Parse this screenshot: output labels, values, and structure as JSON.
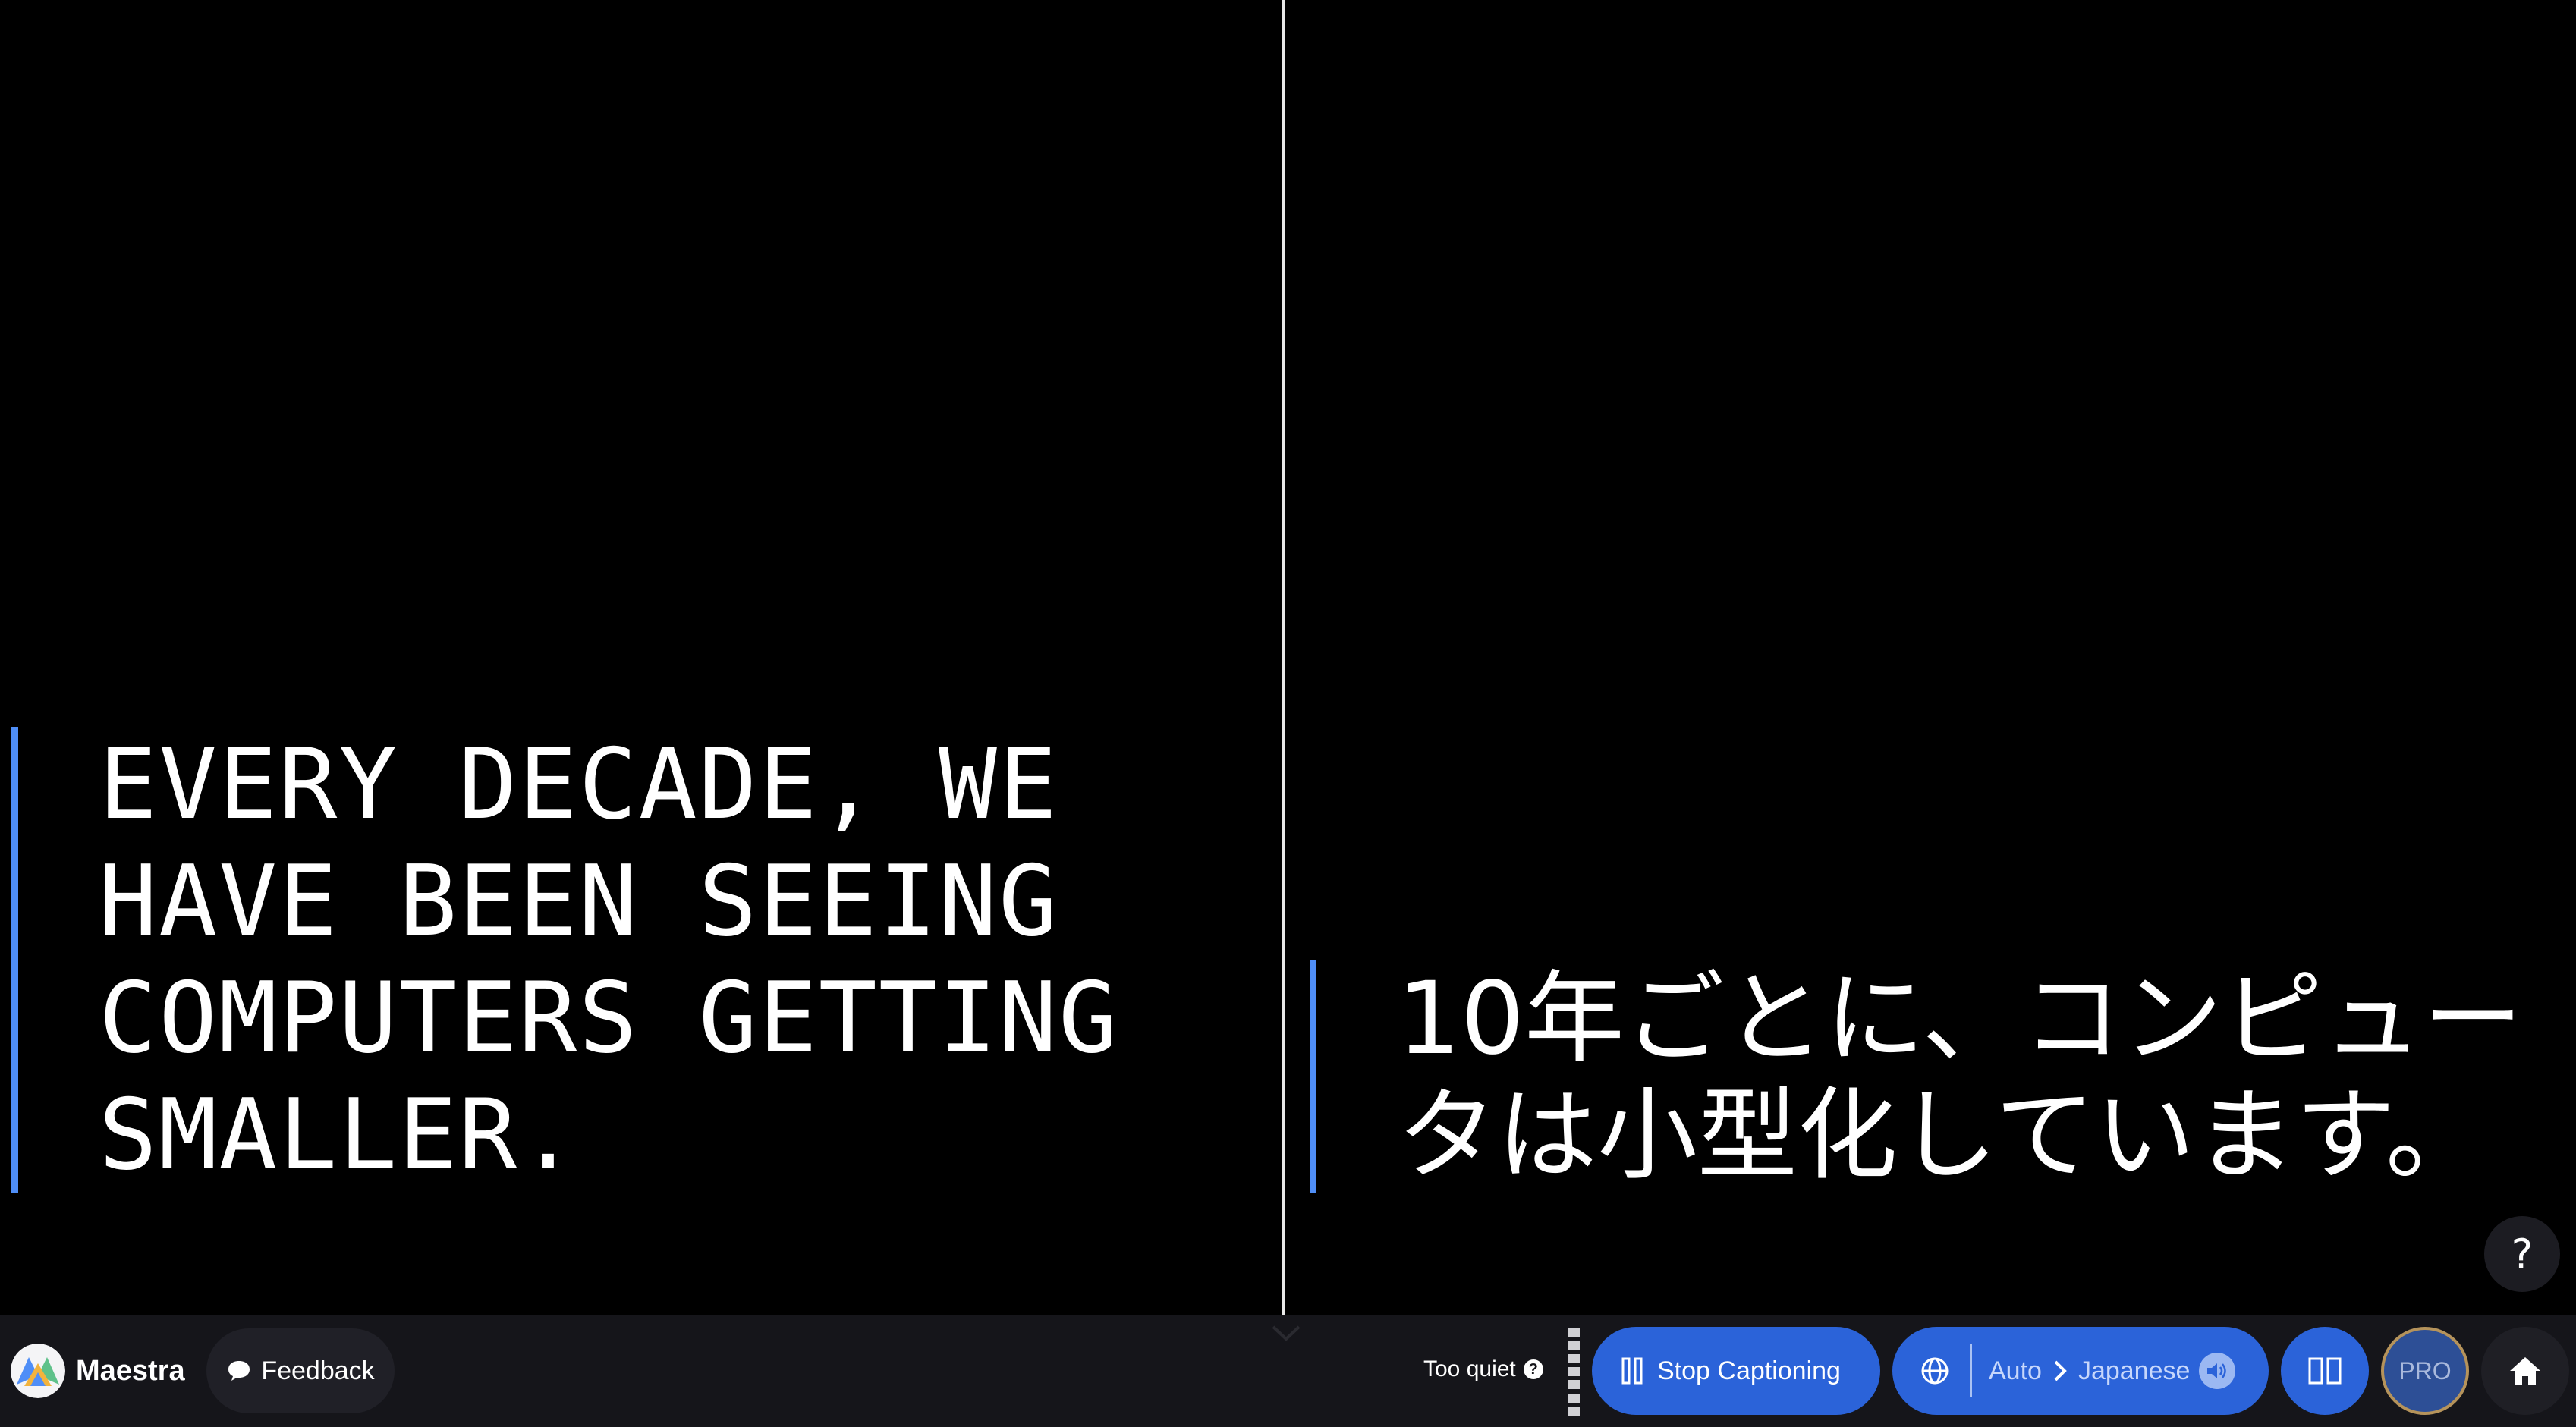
{
  "captions": {
    "source_text": "EVERY DECADE, WE HAVE BEEN SEEING COMPUTERS GETTING SMALLER.",
    "translated_text": "10年ごとに、コンピュータは小型化しています。"
  },
  "help_button": {
    "label": "?"
  },
  "bottom_bar": {
    "brand_name": "Maestra",
    "feedback_label": "Feedback",
    "audio_status": "Too quiet",
    "audio_status_help": "?",
    "stop_label": "Stop Captioning",
    "source_language": "Auto",
    "target_language": "Japanese",
    "pro_label": "PRO"
  },
  "colors": {
    "accent_blue": "#2b63d9",
    "caption_bar": "#4f8ef7",
    "background": "#000000",
    "bar_background": "#15151a"
  }
}
